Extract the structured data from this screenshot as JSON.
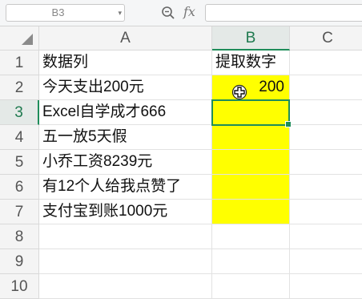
{
  "formula_bar": {
    "name_box": "B3",
    "fx_label": "fx",
    "formula_value": ""
  },
  "columns": [
    "A",
    "B",
    "C"
  ],
  "rows": [
    {
      "num": "1",
      "a": "数据列",
      "b": ""
    },
    {
      "num": "2",
      "a": "今天支出200元",
      "b": "200"
    },
    {
      "num": "3",
      "a": "Excel自学成才666",
      "b": ""
    },
    {
      "num": "4",
      "a": "五一放5天假",
      "b": ""
    },
    {
      "num": "5",
      "a": "小乔工资8239元",
      "b": ""
    },
    {
      "num": "6",
      "a": "有12个人给我点赞了",
      "b": ""
    },
    {
      "num": "7",
      "a": "支付宝到账1000元",
      "b": ""
    },
    {
      "num": "8",
      "a": "",
      "b": ""
    },
    {
      "num": "9",
      "a": "",
      "b": ""
    },
    {
      "num": "10",
      "a": "",
      "b": ""
    }
  ],
  "header_b1": "提取数字",
  "highlight_color": "#ffff00",
  "accent_color": "#1f8d5a",
  "active_cell": "B3"
}
